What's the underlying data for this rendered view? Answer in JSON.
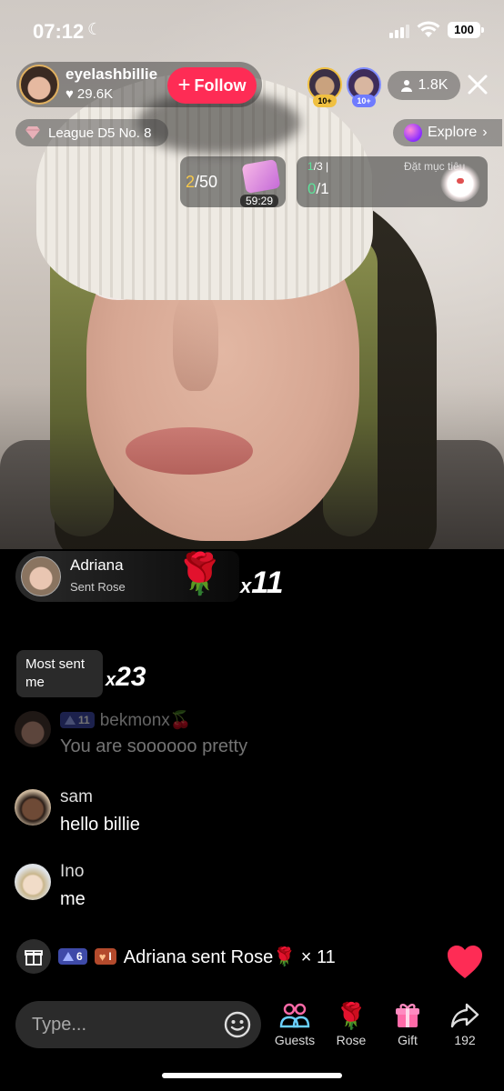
{
  "status_bar": {
    "time": "07:12",
    "battery": "100"
  },
  "host": {
    "name": "eyelashbillie",
    "likes": "29.6K",
    "follow_label": "Follow"
  },
  "top_viewers": [
    {
      "badge": "10+"
    },
    {
      "badge": "10+"
    }
  ],
  "viewer_count": "1.8K",
  "league": {
    "label": "League D5 No. 8"
  },
  "explore": {
    "label": "Explore"
  },
  "gift_goal": {
    "current": "2",
    "total": "/50",
    "timer": "59:29"
  },
  "task": {
    "progress_current": "1",
    "progress_total": "/3",
    "label": "Đặt mục tiêu",
    "value_current": "0",
    "value_total": "/1"
  },
  "gift_banner": {
    "sender": "Adriana",
    "action": "Sent Rose",
    "gift_emoji": "🌹",
    "combo_prefix": "x",
    "combo": "11"
  },
  "most_sent": {
    "label": "Most sent me",
    "combo_prefix": "x",
    "combo": "23"
  },
  "chat": [
    {
      "username": "bekmonx🍒",
      "level": "11",
      "message": "You are soooooo pretty"
    },
    {
      "username": "sam",
      "message": "hello billie"
    },
    {
      "username": "Ino",
      "message": "me"
    }
  ],
  "system_line": {
    "level": "6",
    "fan_level": "I",
    "text": "Adriana sent Rose🌹 × 11"
  },
  "bottom": {
    "input_placeholder": "Type...",
    "buttons": [
      {
        "label": "Guests",
        "icon": "guests-icon"
      },
      {
        "label": "Rose",
        "icon": "rose-icon"
      },
      {
        "label": "Gift",
        "icon": "gift-icon"
      },
      {
        "label": "192",
        "icon": "share-icon"
      }
    ]
  },
  "colors": {
    "follow": "#fe2c55",
    "accent_gold": "#f6c84a",
    "accent_green": "#5de29a",
    "heart": "#fe2c55"
  }
}
